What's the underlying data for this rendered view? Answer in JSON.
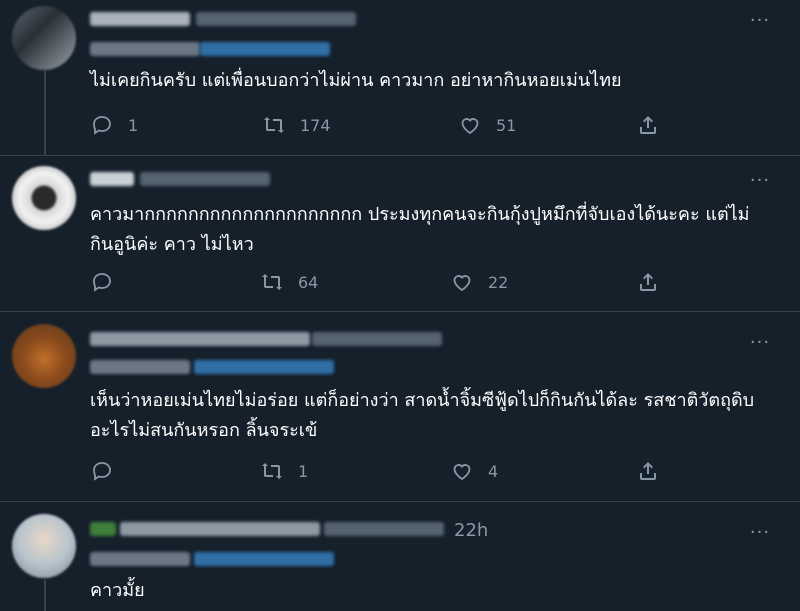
{
  "theme": {
    "background": "#15202b",
    "text_color": "#ffffff",
    "muted_color": "#8899a6",
    "divider_color": "#38444d"
  },
  "more_label": "···",
  "tweets": [
    {
      "text": "ไม่เคยกินครับ แต่เพื่อนบอกว่าไม่ผ่าน คาวมาก อย่าหากินหอยเม่นไทย",
      "replies": "1",
      "retweets": "174",
      "likes": "51"
    },
    {
      "text": "คาวมากกกกกกกกกกกกกกกกกกกก ประมงทุกคนจะกินกุ้งปูหมึกที่จับเองได้นะคะ แต่ไม่กินอูนิค่ะ คาว ไม่ไหว",
      "replies": "",
      "retweets": "64",
      "likes": "22"
    },
    {
      "text": "เห็นว่าหอยเม่นไทยไม่อร่อย แต่ก็อย่างว่า สาดน้ำจิ้มซีฟู้ดไปก็กินกันได้ละ รสชาติวัตถุดิบอะไรไม่สนกันหรอก ลิ้นจระเข้",
      "replies": "",
      "retweets": "1",
      "likes": "4"
    },
    {
      "timestamp": "22h",
      "text": "คาวมั้ย"
    }
  ]
}
